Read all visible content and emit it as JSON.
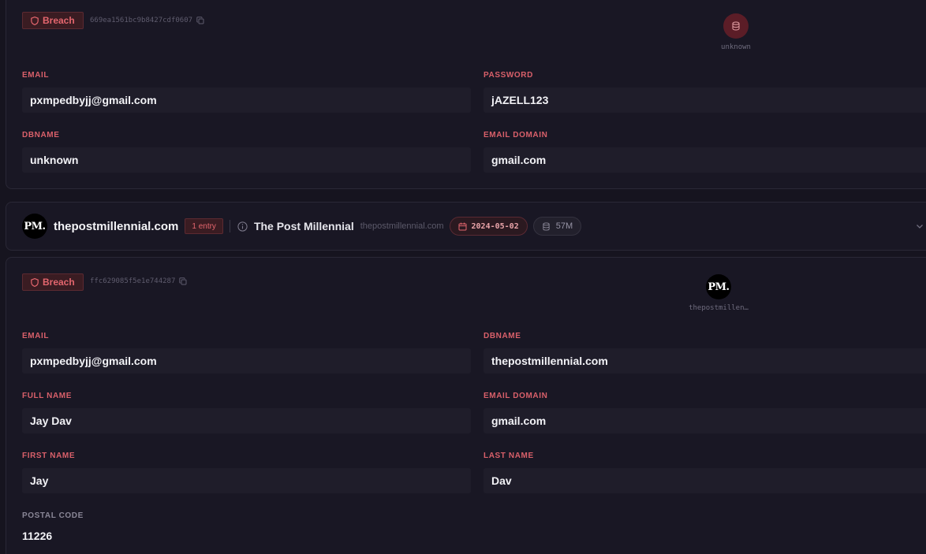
{
  "breach_record_1": {
    "badge_label": "Breach",
    "hash": "669ea1561bc9b8427cdf0607",
    "source_label": "unknown",
    "fields": [
      {
        "label": "EMAIL",
        "value": "pxmpedbyjj@gmail.com"
      },
      {
        "label": "PASSWORD",
        "value": "jAZELL123"
      },
      {
        "label": "DBNAME",
        "value": "unknown"
      },
      {
        "label": "EMAIL DOMAIN",
        "value": "gmail.com"
      }
    ]
  },
  "group": {
    "logo_text": "PM.",
    "domain": "thepostmillennial.com",
    "entries": "1 entry",
    "name": "The Post Millennial",
    "url": "thepostmillennial.com",
    "date": "2024-05-02",
    "size": "57M"
  },
  "breach_record_2": {
    "badge_label": "Breach",
    "hash": "ffc629085f5e1e744287",
    "logo_text": "PM.",
    "source_label": "thepostmillen…",
    "fields": [
      {
        "label": "EMAIL",
        "value": "pxmpedbyjj@gmail.com"
      },
      {
        "label": "DBNAME",
        "value": "thepostmillennial.com"
      },
      {
        "label": "FULL NAME",
        "value": "Jay Dav"
      },
      {
        "label": "EMAIL DOMAIN",
        "value": "gmail.com"
      },
      {
        "label": "FIRST NAME",
        "value": "Jay"
      },
      {
        "label": "LAST NAME",
        "value": "Dav"
      },
      {
        "label": "POSTAL CODE",
        "value": "11226"
      }
    ]
  },
  "colors": {
    "background": "#16141f",
    "card": "#191724",
    "accent_red": "#e4666e",
    "label_red": "#d9606a"
  },
  "icons": [
    "shield-icon",
    "copy-icon",
    "database-icon",
    "info-icon",
    "calendar-icon",
    "chevron-down-icon"
  ]
}
